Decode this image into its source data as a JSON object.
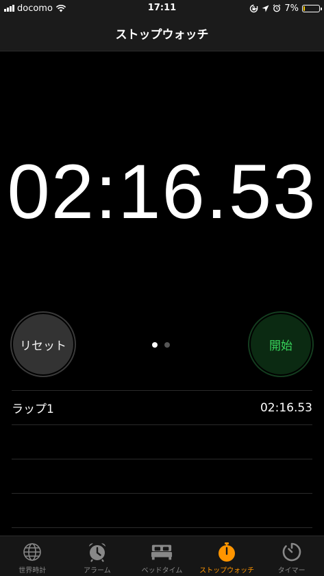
{
  "status_bar": {
    "carrier": "docomo",
    "time": "17:11",
    "battery_percent": "7%",
    "battery_level": 0.07
  },
  "header": {
    "title": "ストップウォッチ"
  },
  "timer": {
    "display": "02:16.53"
  },
  "controls": {
    "reset_label": "リセット",
    "start_label": "開始",
    "page_count": 2,
    "active_page": 1
  },
  "laps": [
    {
      "name": "ラップ1",
      "time": "02:16.53"
    }
  ],
  "tabs": [
    {
      "label": "世界時計",
      "icon": "globe-icon",
      "active": false
    },
    {
      "label": "アラーム",
      "icon": "alarm-clock-icon",
      "active": false
    },
    {
      "label": "ベッドタイム",
      "icon": "bed-icon",
      "active": false
    },
    {
      "label": "ストップウォッチ",
      "icon": "stopwatch-icon",
      "active": true
    },
    {
      "label": "タイマー",
      "icon": "timer-icon",
      "active": false
    }
  ],
  "colors": {
    "accent": "#ff9500",
    "start_text": "#37d35a",
    "start_background": "#0b2a12",
    "reset_background": "#333333",
    "battery_low": "#ffcc00"
  }
}
